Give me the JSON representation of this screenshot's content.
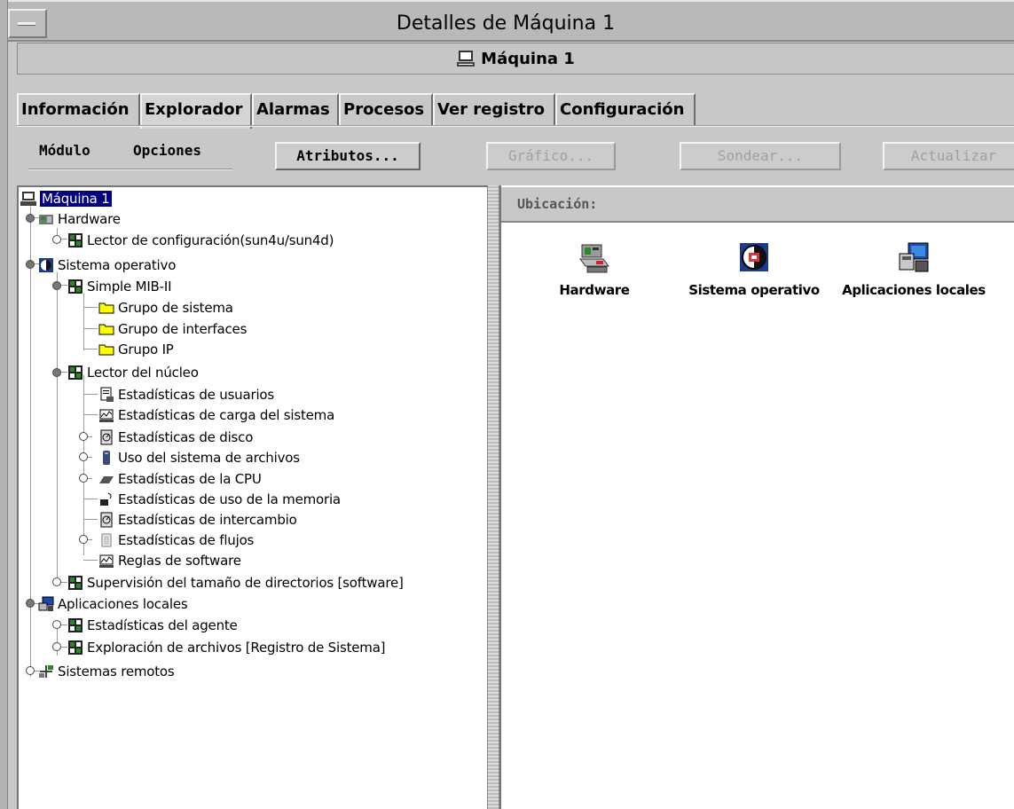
{
  "window": {
    "title": "Detalles de Máquina 1",
    "host_label": "Máquina 1"
  },
  "tabs": [
    {
      "label": "Información",
      "active": false
    },
    {
      "label": "Explorador",
      "active": true
    },
    {
      "label": "Alarmas",
      "active": false
    },
    {
      "label": "Procesos",
      "active": false
    },
    {
      "label": "Ver registro",
      "active": false
    },
    {
      "label": "Configuración",
      "active": false
    }
  ],
  "toolbar": {
    "menu_modulo": "Módulo",
    "menu_opciones": "Opciones",
    "atributos": "Atributos...",
    "grafico": "Gráfico...",
    "sondear": "Sondear...",
    "actualizar": "Actualizar"
  },
  "tree": {
    "root": "Máquina 1",
    "hardware": "Hardware",
    "lector_config": "Lector de configuración(sun4u/sun4d)",
    "so": "Sistema operativo",
    "mib": "Simple MIB-II",
    "grupo_sistema": "Grupo de sistema",
    "grupo_interfaces": "Grupo de interfaces",
    "grupo_ip": "Grupo IP",
    "lector_nucleo": "Lector del núcleo",
    "est_usuarios": "Estadísticas de usuarios",
    "est_carga": "Estadísticas de carga del sistema",
    "est_disco": "Estadísticas de disco",
    "uso_fs": "Uso del sistema de archivos",
    "est_cpu": "Estadísticas de la CPU",
    "est_memoria": "Estadísticas de uso de la memoria",
    "est_intercambio": "Estadísticas de intercambio",
    "est_flujos": "Estadísticas de flujos",
    "reglas_sw": "Reglas de software",
    "sup_dir": "Supervisión del tamaño de directorios [software]",
    "apps_locales": "Aplicaciones locales",
    "est_agente": "Estadísticas del agente",
    "expl_archivos": "Exploración de archivos [Registro de Sistema]",
    "remotos": "Sistemas remotos"
  },
  "location": {
    "label": "Ubicación:",
    "items": [
      {
        "label": "Hardware",
        "icon": "hardware-icon"
      },
      {
        "label": "Sistema operativo",
        "icon": "operating-system-icon"
      },
      {
        "label": "Aplicaciones locales",
        "icon": "local-applications-icon"
      }
    ]
  },
  "colors": {
    "selection": "#000080",
    "folder": "#ffff00",
    "module_green": "#2a8a2a"
  }
}
